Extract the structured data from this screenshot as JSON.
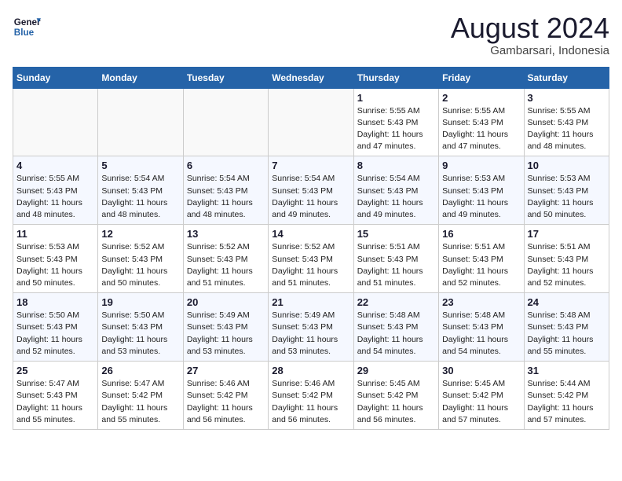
{
  "header": {
    "logo_line1": "General",
    "logo_line2": "Blue",
    "month_year": "August 2024",
    "location": "Gambarsari, Indonesia"
  },
  "days_of_week": [
    "Sunday",
    "Monday",
    "Tuesday",
    "Wednesday",
    "Thursday",
    "Friday",
    "Saturday"
  ],
  "weeks": [
    [
      {
        "day": "",
        "sunrise": "",
        "sunset": "",
        "daylight": "",
        "empty": true
      },
      {
        "day": "",
        "sunrise": "",
        "sunset": "",
        "daylight": "",
        "empty": true
      },
      {
        "day": "",
        "sunrise": "",
        "sunset": "",
        "daylight": "",
        "empty": true
      },
      {
        "day": "",
        "sunrise": "",
        "sunset": "",
        "daylight": "",
        "empty": true
      },
      {
        "day": "1",
        "sunrise": "5:55 AM",
        "sunset": "5:43 PM",
        "daylight": "11 hours and 47 minutes.",
        "empty": false
      },
      {
        "day": "2",
        "sunrise": "5:55 AM",
        "sunset": "5:43 PM",
        "daylight": "11 hours and 47 minutes.",
        "empty": false
      },
      {
        "day": "3",
        "sunrise": "5:55 AM",
        "sunset": "5:43 PM",
        "daylight": "11 hours and 48 minutes.",
        "empty": false
      }
    ],
    [
      {
        "day": "4",
        "sunrise": "5:55 AM",
        "sunset": "5:43 PM",
        "daylight": "11 hours and 48 minutes.",
        "empty": false
      },
      {
        "day": "5",
        "sunrise": "5:54 AM",
        "sunset": "5:43 PM",
        "daylight": "11 hours and 48 minutes.",
        "empty": false
      },
      {
        "day": "6",
        "sunrise": "5:54 AM",
        "sunset": "5:43 PM",
        "daylight": "11 hours and 48 minutes.",
        "empty": false
      },
      {
        "day": "7",
        "sunrise": "5:54 AM",
        "sunset": "5:43 PM",
        "daylight": "11 hours and 49 minutes.",
        "empty": false
      },
      {
        "day": "8",
        "sunrise": "5:54 AM",
        "sunset": "5:43 PM",
        "daylight": "11 hours and 49 minutes.",
        "empty": false
      },
      {
        "day": "9",
        "sunrise": "5:53 AM",
        "sunset": "5:43 PM",
        "daylight": "11 hours and 49 minutes.",
        "empty": false
      },
      {
        "day": "10",
        "sunrise": "5:53 AM",
        "sunset": "5:43 PM",
        "daylight": "11 hours and 50 minutes.",
        "empty": false
      }
    ],
    [
      {
        "day": "11",
        "sunrise": "5:53 AM",
        "sunset": "5:43 PM",
        "daylight": "11 hours and 50 minutes.",
        "empty": false
      },
      {
        "day": "12",
        "sunrise": "5:52 AM",
        "sunset": "5:43 PM",
        "daylight": "11 hours and 50 minutes.",
        "empty": false
      },
      {
        "day": "13",
        "sunrise": "5:52 AM",
        "sunset": "5:43 PM",
        "daylight": "11 hours and 51 minutes.",
        "empty": false
      },
      {
        "day": "14",
        "sunrise": "5:52 AM",
        "sunset": "5:43 PM",
        "daylight": "11 hours and 51 minutes.",
        "empty": false
      },
      {
        "day": "15",
        "sunrise": "5:51 AM",
        "sunset": "5:43 PM",
        "daylight": "11 hours and 51 minutes.",
        "empty": false
      },
      {
        "day": "16",
        "sunrise": "5:51 AM",
        "sunset": "5:43 PM",
        "daylight": "11 hours and 52 minutes.",
        "empty": false
      },
      {
        "day": "17",
        "sunrise": "5:51 AM",
        "sunset": "5:43 PM",
        "daylight": "11 hours and 52 minutes.",
        "empty": false
      }
    ],
    [
      {
        "day": "18",
        "sunrise": "5:50 AM",
        "sunset": "5:43 PM",
        "daylight": "11 hours and 52 minutes.",
        "empty": false
      },
      {
        "day": "19",
        "sunrise": "5:50 AM",
        "sunset": "5:43 PM",
        "daylight": "11 hours and 53 minutes.",
        "empty": false
      },
      {
        "day": "20",
        "sunrise": "5:49 AM",
        "sunset": "5:43 PM",
        "daylight": "11 hours and 53 minutes.",
        "empty": false
      },
      {
        "day": "21",
        "sunrise": "5:49 AM",
        "sunset": "5:43 PM",
        "daylight": "11 hours and 53 minutes.",
        "empty": false
      },
      {
        "day": "22",
        "sunrise": "5:48 AM",
        "sunset": "5:43 PM",
        "daylight": "11 hours and 54 minutes.",
        "empty": false
      },
      {
        "day": "23",
        "sunrise": "5:48 AM",
        "sunset": "5:43 PM",
        "daylight": "11 hours and 54 minutes.",
        "empty": false
      },
      {
        "day": "24",
        "sunrise": "5:48 AM",
        "sunset": "5:43 PM",
        "daylight": "11 hours and 55 minutes.",
        "empty": false
      }
    ],
    [
      {
        "day": "25",
        "sunrise": "5:47 AM",
        "sunset": "5:43 PM",
        "daylight": "11 hours and 55 minutes.",
        "empty": false
      },
      {
        "day": "26",
        "sunrise": "5:47 AM",
        "sunset": "5:42 PM",
        "daylight": "11 hours and 55 minutes.",
        "empty": false
      },
      {
        "day": "27",
        "sunrise": "5:46 AM",
        "sunset": "5:42 PM",
        "daylight": "11 hours and 56 minutes.",
        "empty": false
      },
      {
        "day": "28",
        "sunrise": "5:46 AM",
        "sunset": "5:42 PM",
        "daylight": "11 hours and 56 minutes.",
        "empty": false
      },
      {
        "day": "29",
        "sunrise": "5:45 AM",
        "sunset": "5:42 PM",
        "daylight": "11 hours and 56 minutes.",
        "empty": false
      },
      {
        "day": "30",
        "sunrise": "5:45 AM",
        "sunset": "5:42 PM",
        "daylight": "11 hours and 57 minutes.",
        "empty": false
      },
      {
        "day": "31",
        "sunrise": "5:44 AM",
        "sunset": "5:42 PM",
        "daylight": "11 hours and 57 minutes.",
        "empty": false
      }
    ]
  ]
}
